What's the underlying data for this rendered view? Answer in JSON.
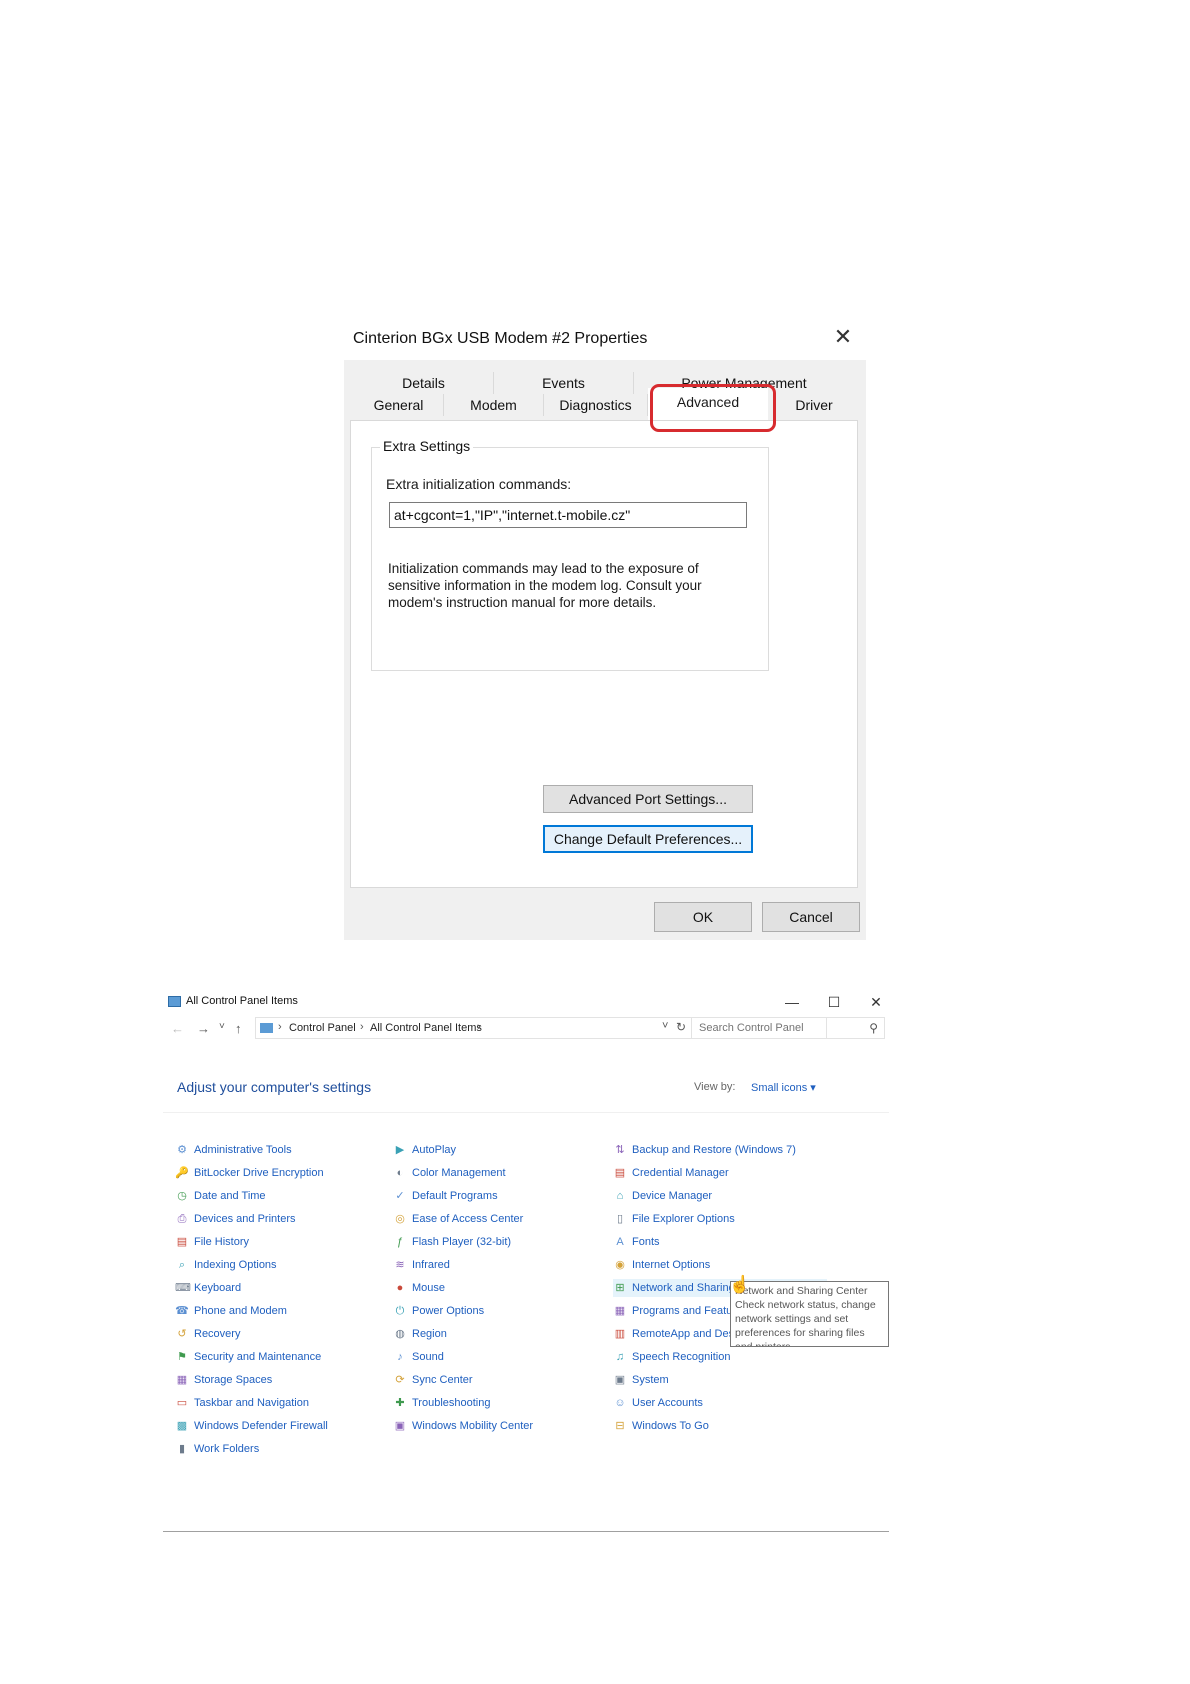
{
  "dialog": {
    "title": "Cinterion BGx USB Modem #2 Properties",
    "close_glyph": "✕",
    "tabs_back": [
      "Details",
      "Events",
      "Power Management"
    ],
    "tabs_front": [
      "General",
      "Modem",
      "Diagnostics",
      "Driver"
    ],
    "active_tab": "Advanced",
    "group_title": "Extra Settings",
    "init_label": "Extra initialization commands:",
    "init_value": "at+cgcont=1,\"IP\",\"internet.t-mobile.cz\"",
    "note": "Initialization commands may lead to the exposure of sensitive information in the modem log. Consult your modem's instruction manual for more details.",
    "advanced_port_button": "Advanced Port Settings...",
    "change_defaults_button": "Change Default Preferences...",
    "ok_button": "OK",
    "cancel_button": "Cancel",
    "annotation_color": "#d72b2f"
  },
  "control_panel": {
    "title": "All Control Panel Items",
    "window_buttons": {
      "minimize": "—",
      "maximize": "☐",
      "close": "✕"
    },
    "nav": {
      "back": "←",
      "forward": "→",
      "recent": "˅",
      "up": "↑",
      "dropdown": "˅",
      "refresh": "↻"
    },
    "breadcrumb": [
      "Control Panel",
      "All Control Panel Items"
    ],
    "breadcrumb_separator": "›",
    "search_placeholder": "Search Control Panel",
    "heading": "Adjust your computer's settings",
    "view_by_label": "View by:",
    "view_by_value": "Small icons ▾",
    "columns": [
      [
        {
          "label": "Administrative Tools",
          "icon": "admin-tools-icon"
        },
        {
          "label": "BitLocker Drive Encryption",
          "icon": "bitlocker-icon"
        },
        {
          "label": "Date and Time",
          "icon": "clock-icon"
        },
        {
          "label": "Devices and Printers",
          "icon": "printer-icon"
        },
        {
          "label": "File History",
          "icon": "file-history-icon"
        },
        {
          "label": "Indexing Options",
          "icon": "indexing-icon"
        },
        {
          "label": "Keyboard",
          "icon": "keyboard-icon"
        },
        {
          "label": "Phone and Modem",
          "icon": "phone-icon"
        },
        {
          "label": "Recovery",
          "icon": "recovery-icon"
        },
        {
          "label": "Security and Maintenance",
          "icon": "flag-icon"
        },
        {
          "label": "Storage Spaces",
          "icon": "storage-icon"
        },
        {
          "label": "Taskbar and Navigation",
          "icon": "taskbar-icon"
        },
        {
          "label": "Windows Defender Firewall",
          "icon": "firewall-icon"
        },
        {
          "label": "Work Folders",
          "icon": "folder-icon"
        }
      ],
      [
        {
          "label": "AutoPlay",
          "icon": "autoplay-icon"
        },
        {
          "label": "Color Management",
          "icon": "color-icon"
        },
        {
          "label": "Default Programs",
          "icon": "default-programs-icon"
        },
        {
          "label": "Ease of Access Center",
          "icon": "ease-of-access-icon"
        },
        {
          "label": "Flash Player (32-bit)",
          "icon": "flash-icon"
        },
        {
          "label": "Infrared",
          "icon": "infrared-icon"
        },
        {
          "label": "Mouse",
          "icon": "mouse-icon"
        },
        {
          "label": "Power Options",
          "icon": "power-icon"
        },
        {
          "label": "Region",
          "icon": "region-icon"
        },
        {
          "label": "Sound",
          "icon": "sound-icon"
        },
        {
          "label": "Sync Center",
          "icon": "sync-icon"
        },
        {
          "label": "Troubleshooting",
          "icon": "troubleshooting-icon"
        },
        {
          "label": "Windows Mobility Center",
          "icon": "mobility-icon"
        }
      ],
      [
        {
          "label": "Backup and Restore (Windows 7)",
          "icon": "backup-icon"
        },
        {
          "label": "Credential Manager",
          "icon": "credential-icon"
        },
        {
          "label": "Device Manager",
          "icon": "device-manager-icon"
        },
        {
          "label": "File Explorer Options",
          "icon": "folder-options-icon"
        },
        {
          "label": "Fonts",
          "icon": "fonts-icon"
        },
        {
          "label": "Internet Options",
          "icon": "internet-icon"
        },
        {
          "label": "Network and Sharing Center",
          "icon": "network-icon"
        },
        {
          "label": "Programs and Features",
          "icon": "programs-icon"
        },
        {
          "label": "RemoteApp and Desktop Connections",
          "icon": "remoteapp-icon"
        },
        {
          "label": "Speech Recognition",
          "icon": "microphone-icon"
        },
        {
          "label": "System",
          "icon": "system-icon"
        },
        {
          "label": "User Accounts",
          "icon": "users-icon"
        },
        {
          "label": "Windows To Go",
          "icon": "windows-to-go-icon"
        }
      ]
    ],
    "tooltip": {
      "title": "Network and Sharing Center",
      "text": "Check network status, change network settings and set preferences for sharing files and printers."
    }
  }
}
